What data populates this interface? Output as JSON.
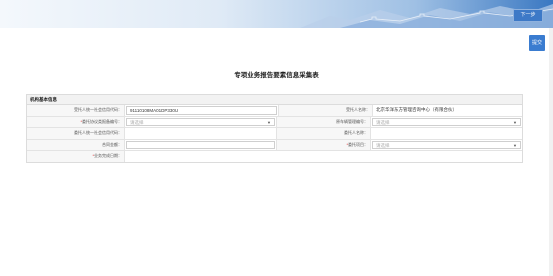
{
  "header": {
    "next_label": "下一步",
    "submit_label": "提交"
  },
  "page_title": "专项业务报告要素信息采集表",
  "section": {
    "title": "机构基本信息",
    "rows": [
      {
        "left_label": "受托人统一社会信用代码：",
        "left_required": false,
        "left_value": "91110108MA01DP330U",
        "left_type": "text",
        "right_label": "受托人名称：",
        "right_required": false,
        "right_value": "北京华洋东方管理咨询中心（有限合伙）",
        "right_type": "text"
      },
      {
        "left_label": "委托协议类报备编号：",
        "left_required": true,
        "left_value": "请选择",
        "left_type": "select",
        "right_label": "原车辆管理编号：",
        "right_required": false,
        "right_value": "请选择",
        "right_type": "select"
      },
      {
        "left_label": "委托人统一社会信用代码：",
        "left_required": false,
        "left_value": "",
        "left_type": "text",
        "right_label": "委托人名称：",
        "right_required": false,
        "right_value": "",
        "right_type": "text"
      },
      {
        "left_label": "合同金额：",
        "left_required": false,
        "left_value": "",
        "left_type": "input",
        "right_label": "委托项目：",
        "right_required": true,
        "right_value": "请选择",
        "right_type": "select"
      }
    ],
    "last_row": {
      "label": "业务完成日期：",
      "required": true,
      "value": ""
    }
  },
  "colors": {
    "accent": "#3a7cd0",
    "required": "#e02020",
    "label_bg": "#f7f7f7"
  }
}
